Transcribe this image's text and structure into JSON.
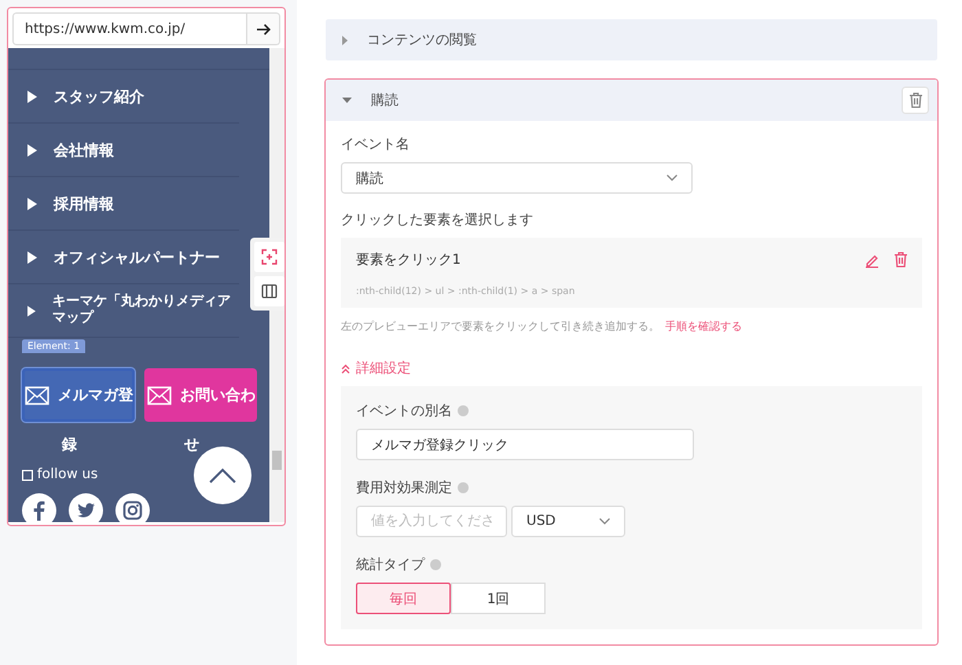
{
  "preview": {
    "url": "https://www.kwm.co.jp/",
    "menu": [
      {
        "label": "スタッフ紹介"
      },
      {
        "label": "会社情報"
      },
      {
        "label": "採用情報"
      },
      {
        "label": "オフィシャルパートナー"
      },
      {
        "label": "キーマケ「丸わかりメディアマップ"
      }
    ],
    "element_tag": "Element: 1",
    "buttons": [
      {
        "label": "メルマガ登",
        "overflow": "録",
        "color": "#4468b4",
        "selected": true
      },
      {
        "label": "お問い合わ",
        "overflow": "せ",
        "color": "#e0369e",
        "selected": false
      }
    ],
    "follow": {
      "label": "follow us",
      "checked": false
    }
  },
  "sections": [
    {
      "title": "コンテンツの閲覧",
      "expanded": false
    },
    {
      "title": "購読",
      "expanded": true,
      "form": {
        "event_name_label": "イベント名",
        "event_name": "購読",
        "select_label": "クリックした要素を選択します",
        "element": {
          "title": "要素をクリック1",
          "selector": ":nth-child(12) > ul > :nth-child(1) > a > span"
        },
        "hint": "左のプレビューエリアで要素をクリックして引き続き追加する。",
        "hint_link": "手順を確認する",
        "advanced": {
          "label": "詳細設定",
          "expanded": true,
          "alias_label": "イベントの別名",
          "alias": "メルマガ登録クリック",
          "cost_label": "費用対効果測定",
          "cost_placeholder": "値を入力してくださ",
          "currency": "USD",
          "type_label": "統計タイプ",
          "type_options": [
            {
              "label": "毎回",
              "selected": true
            },
            {
              "label": "1回",
              "selected": false
            }
          ]
        }
      }
    }
  ]
}
